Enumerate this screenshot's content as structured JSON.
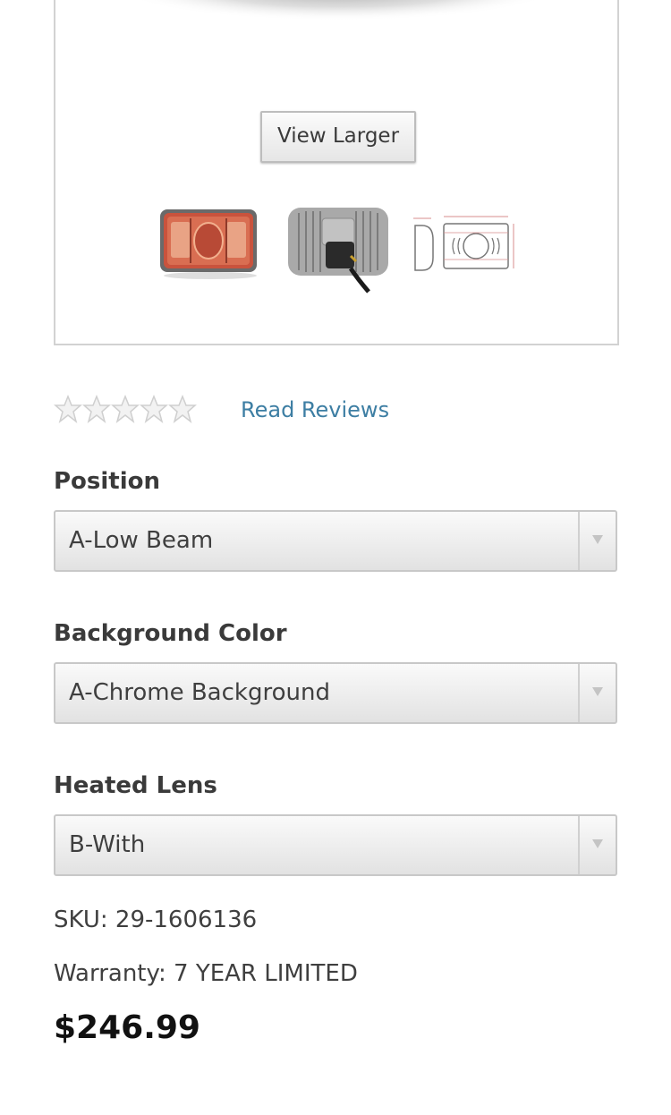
{
  "gallery": {
    "view_larger_label": "View Larger",
    "thumbnails": [
      {
        "icon": "headlight-front-icon"
      },
      {
        "icon": "headlight-back-icon"
      },
      {
        "icon": "headlight-diagram-icon"
      }
    ]
  },
  "rating": {
    "stars": 0,
    "max_stars": 5,
    "read_reviews_label": "Read Reviews",
    "link_color": "#3d7ea3"
  },
  "options": {
    "position": {
      "label": "Position",
      "value": "A-Low Beam"
    },
    "background_color": {
      "label": "Background Color",
      "value": "A-Chrome Background"
    },
    "heated_lens": {
      "label": "Heated Lens",
      "value": "B-With"
    }
  },
  "product": {
    "sku_text": "SKU: 29-1606136",
    "warranty_text": "Warranty: 7 YEAR LIMITED",
    "price": "$246.99"
  }
}
